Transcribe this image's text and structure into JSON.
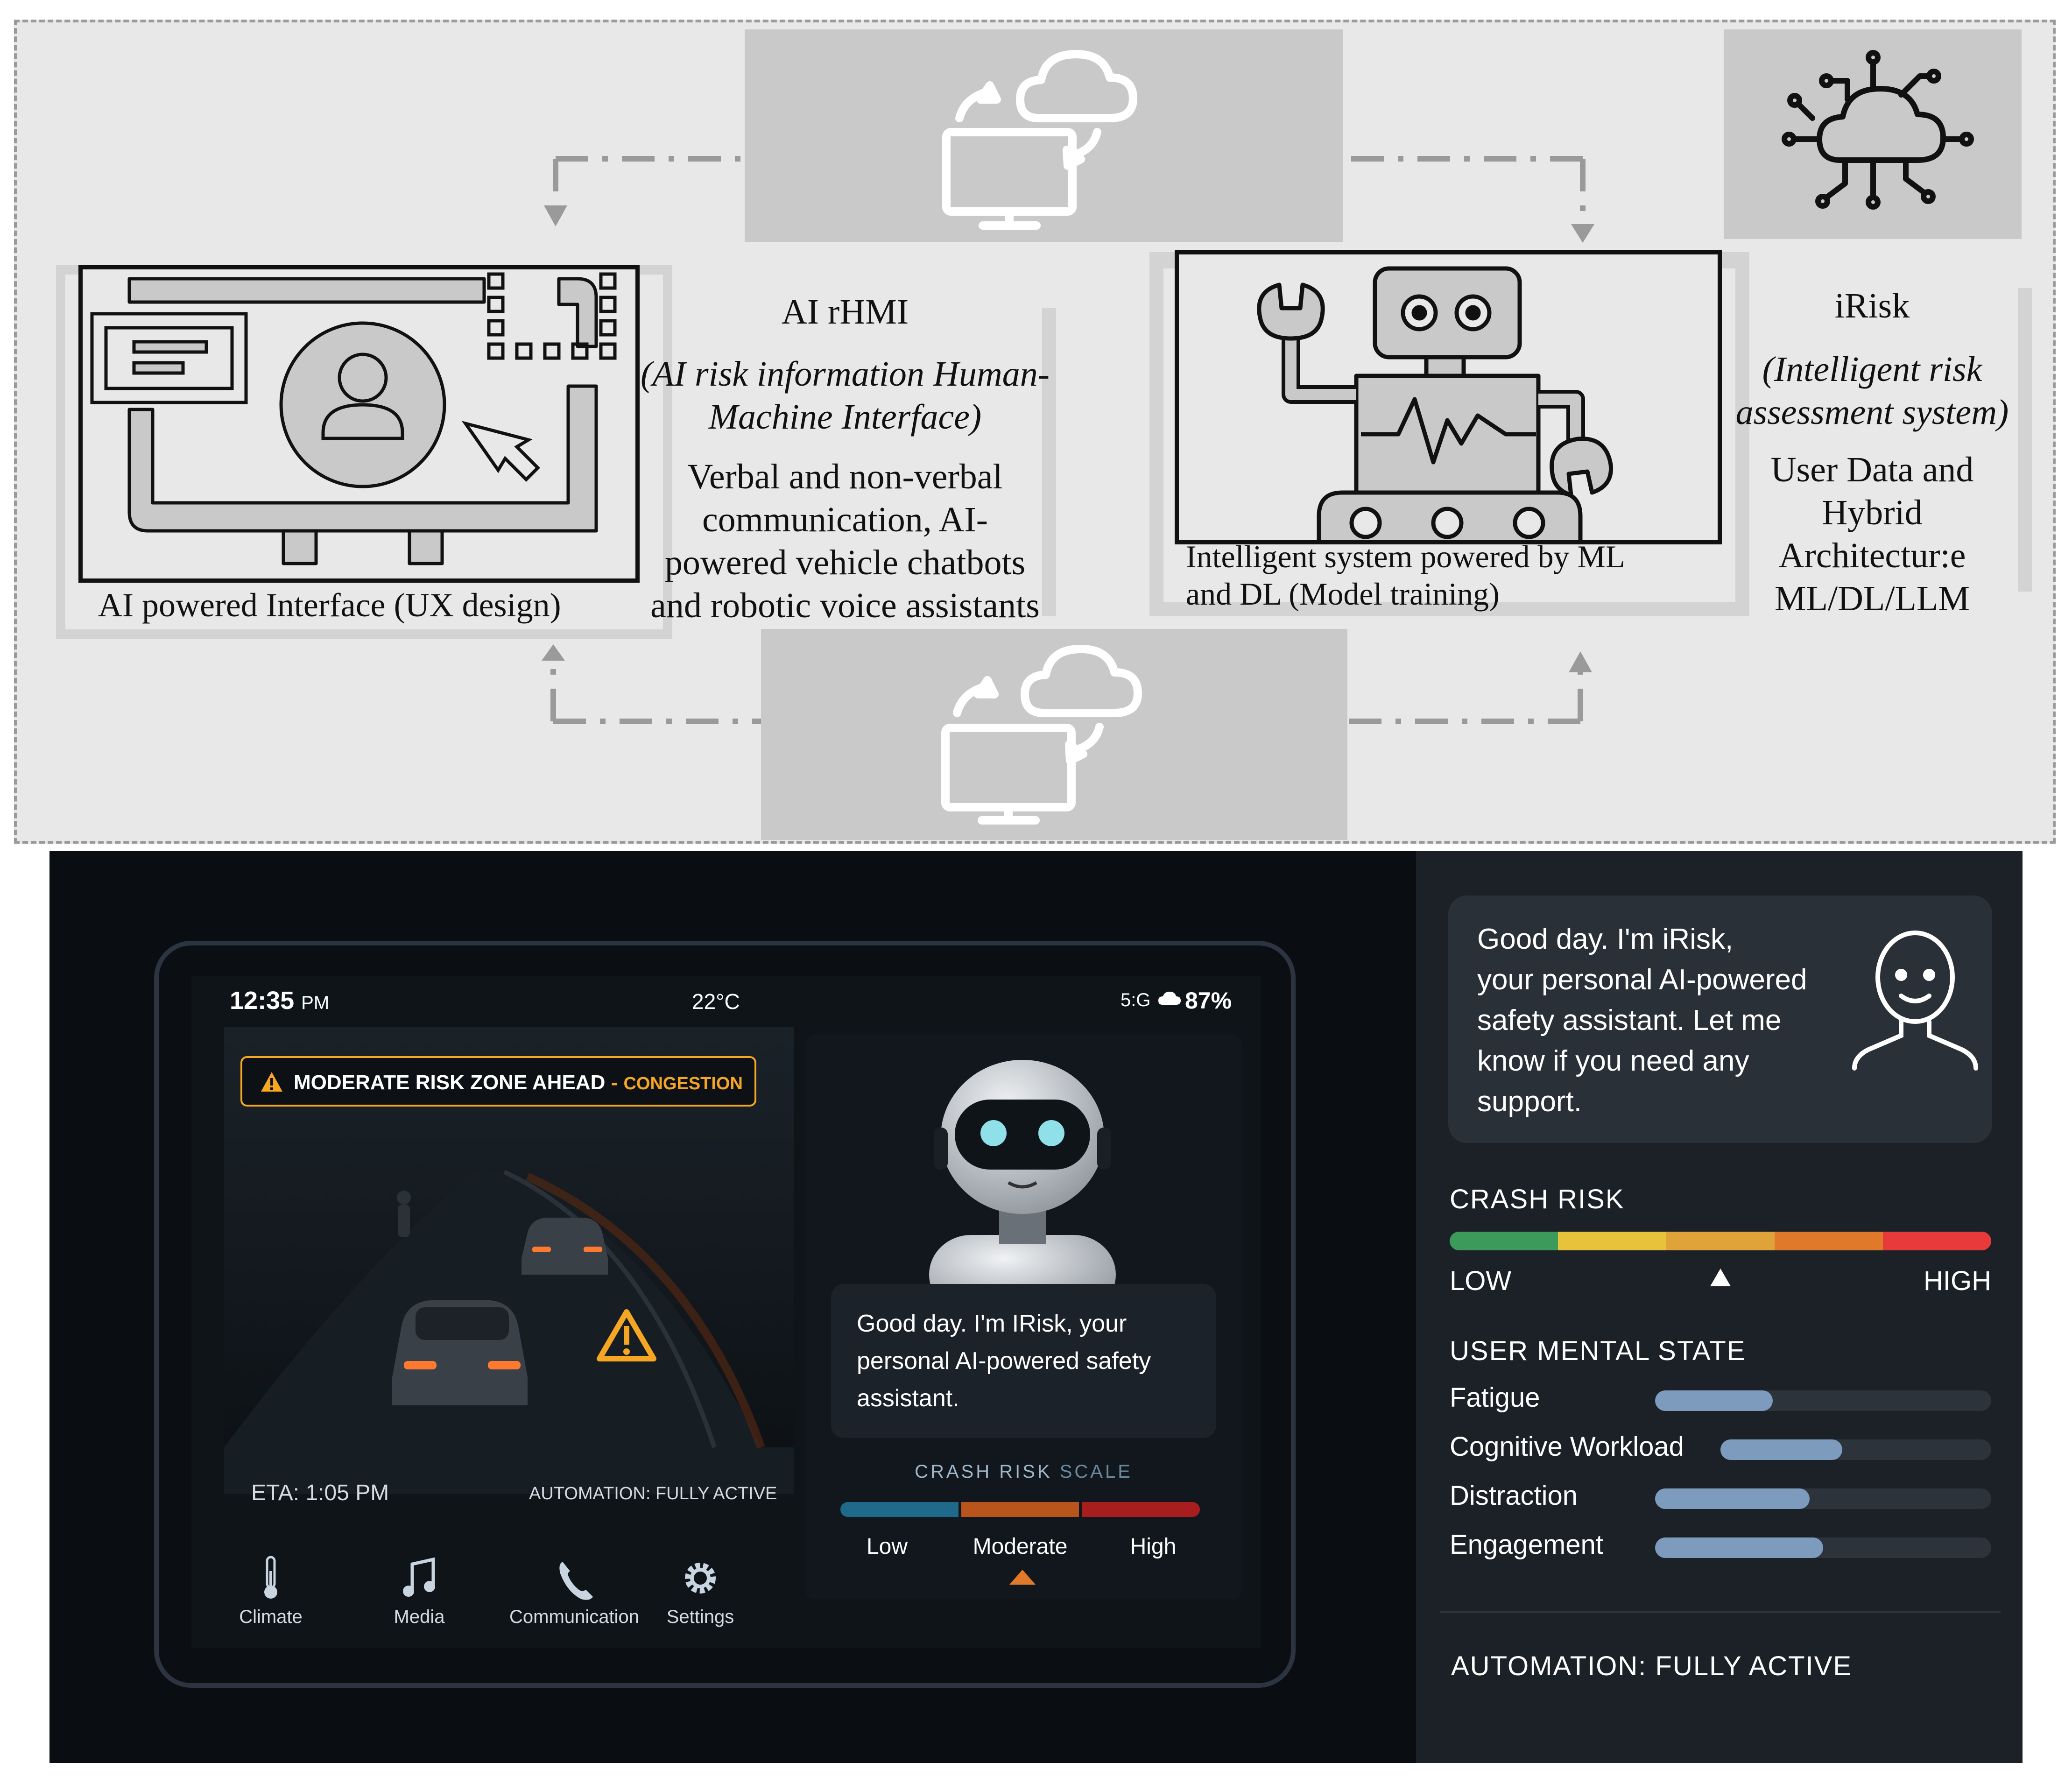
{
  "diagram": {
    "left_caption": "AI powered Interface (UX design)",
    "rhmi": {
      "title": "AI rHMI",
      "subtitle_line1": "(AI risk information Human-",
      "subtitle_line2": "Machine Interface)",
      "desc_line1": "Verbal and non-verbal",
      "desc_line2": "communication, AI-",
      "desc_line3": "powered vehicle chatbots",
      "desc_line4": "and robotic voice assistants"
    },
    "robot_caption_line1": "Intelligent system powered by ML",
    "robot_caption_line2": "and DL (Model training)",
    "irisk": {
      "title": "iRisk",
      "subtitle_line1": "(Intelligent risk",
      "subtitle_line2": "assessment system)",
      "desc_line1": "User Data and",
      "desc_line2": "Hybrid",
      "desc_line3": "Architectur:e",
      "desc_line4": "ML/DL/LLM"
    }
  },
  "screen": {
    "time": "12:35",
    "ampm": "PM",
    "temperature": "22°C",
    "network": "5:G",
    "battery": "87%",
    "alert_main": "MODERATE RISK ZONE AHEAD",
    "alert_sep": " - ",
    "alert_detail": "CONGESTION",
    "eta": "ETA: 1:05 PM",
    "automation": "AUTOMATION: FULLY ACTIVE",
    "assistant_message_line1": "Good day. I'm IRisk, your",
    "assistant_message_line2": "personal AI-powered safety",
    "assistant_message_line3": "assistant.",
    "scale_title_a": "CRASH RISK",
    "scale_title_b": "SCALE",
    "scale_labels": [
      "Low",
      "Moderate",
      "High"
    ],
    "scale_indicator": "Moderate",
    "nav": [
      {
        "label": "Climate",
        "icon": "thermometer-icon"
      },
      {
        "label": "Media",
        "icon": "music-note-icon"
      },
      {
        "label": "Communication",
        "icon": "phone-icon"
      },
      {
        "label": "Settings",
        "icon": "gear-icon"
      }
    ],
    "colors": {
      "accent": "#f5a623",
      "scale": [
        "#1f6a8a",
        "#b8541c",
        "#a81e1e"
      ]
    }
  },
  "side": {
    "greeting_line1": "Good day. I'm iRisk,",
    "greeting_line2": "your personal AI-powered",
    "greeting_line3": "safety assistant. Let me",
    "greeting_line4": "know if you need any",
    "greeting_line5": "support.",
    "crash_risk_label": "CRASH RISK",
    "low_label": "LOW",
    "high_label": "HIGH",
    "crash_risk_level": 0.5,
    "mental_state_label": "USER MENTAL STATE",
    "metrics": [
      {
        "label": "Fatigue",
        "value": 0.35
      },
      {
        "label": "Cognitive Workload",
        "value": 0.45
      },
      {
        "label": "Distraction",
        "value": 0.46
      },
      {
        "label": "Engagement",
        "value": 0.5
      }
    ],
    "automation": "AUTOMATION: FULLY ACTIVE",
    "colors": {
      "risk_gradient": [
        "#3c9a5a",
        "#e8c23a",
        "#e0a33a",
        "#e07a2a",
        "#e83a3a"
      ],
      "metric_bar": "#7d9bbd"
    }
  }
}
